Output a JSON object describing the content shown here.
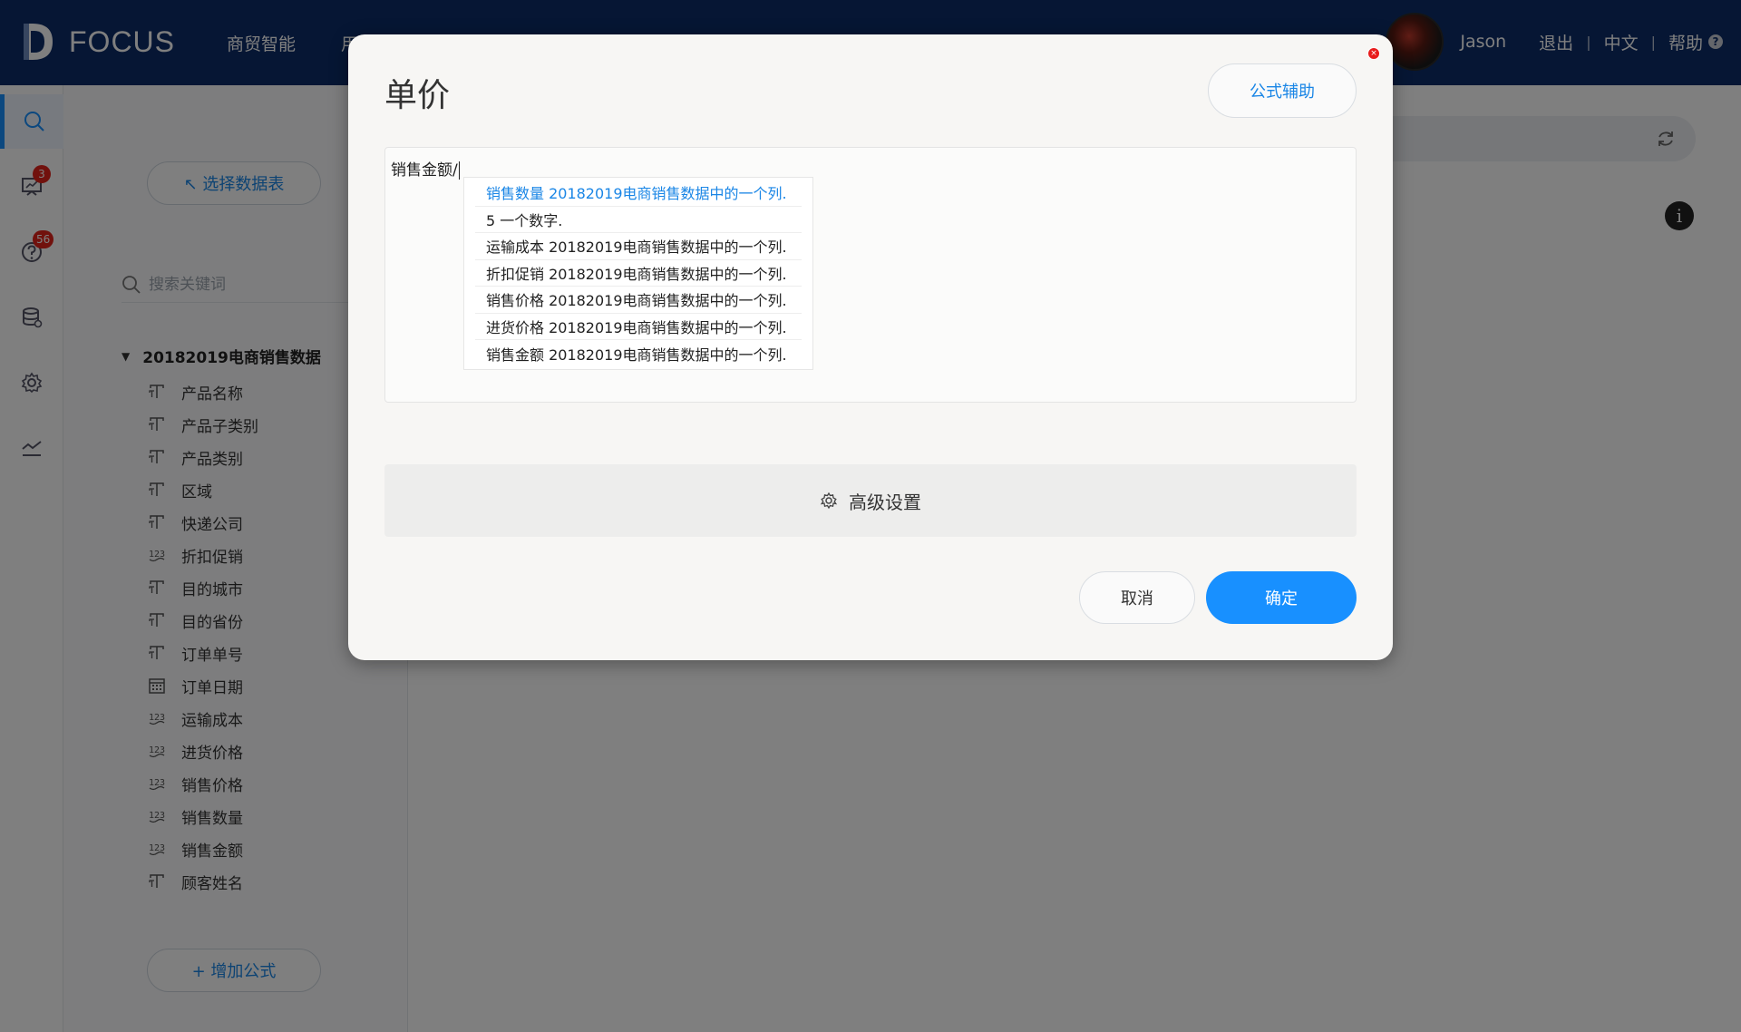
{
  "topbar": {
    "logo_text": "FOCUS",
    "nav": [
      "商贸智能",
      "用"
    ],
    "user_name": "Jason",
    "logout": "退出",
    "language": "中文",
    "help": "帮助",
    "help_icon_glyph": "?",
    "separator": "|"
  },
  "rail": {
    "items": [
      {
        "icon": "search-icon"
      },
      {
        "icon": "board-icon",
        "badge": "3"
      },
      {
        "icon": "question-icon",
        "badge": "56"
      },
      {
        "icon": "database-icon"
      },
      {
        "icon": "gear-icon"
      },
      {
        "icon": "trend-icon"
      }
    ]
  },
  "panel": {
    "select_table_label": "↖ 选择数据表",
    "search_placeholder": "搜索关键词",
    "table_name": "20182019电商销售数据",
    "caret": "▼",
    "fields": [
      {
        "label": "产品名称",
        "type": "text"
      },
      {
        "label": "产品子类别",
        "type": "text"
      },
      {
        "label": "产品类别",
        "type": "text"
      },
      {
        "label": "区域",
        "type": "text"
      },
      {
        "label": "快递公司",
        "type": "text"
      },
      {
        "label": "折扣促销",
        "type": "number"
      },
      {
        "label": "目的城市",
        "type": "text"
      },
      {
        "label": "目的省份",
        "type": "text"
      },
      {
        "label": "订单单号",
        "type": "text"
      },
      {
        "label": "订单日期",
        "type": "date"
      },
      {
        "label": "运输成本",
        "type": "number"
      },
      {
        "label": "进货价格",
        "type": "number"
      },
      {
        "label": "销售价格",
        "type": "number"
      },
      {
        "label": "销售数量",
        "type": "number"
      },
      {
        "label": "销售金额",
        "type": "number"
      },
      {
        "label": "顾客姓名",
        "type": "text"
      }
    ],
    "add_formula_label": "+ 增加公式"
  },
  "main": {
    "info_glyph": "i"
  },
  "modal": {
    "close_glyph": "×",
    "title": "单价",
    "formula_help": "公式辅助",
    "editor_text": "销售金额/",
    "suggestions": [
      "销售数量 20182019电商销售数据中的一个列.",
      "5 一个数字.",
      "运输成本 20182019电商销售数据中的一个列.",
      "折扣促销 20182019电商销售数据中的一个列.",
      "销售价格 20182019电商销售数据中的一个列.",
      "进货价格 20182019电商销售数据中的一个列.",
      "销售金额 20182019电商销售数据中的一个列."
    ],
    "advanced_label": "高级设置",
    "cancel_label": "取消",
    "confirm_label": "确定"
  },
  "colors": {
    "topbar": "#0d2d69",
    "accent": "#1890ff",
    "link": "#1a86e6",
    "badge": "#e2231a"
  }
}
